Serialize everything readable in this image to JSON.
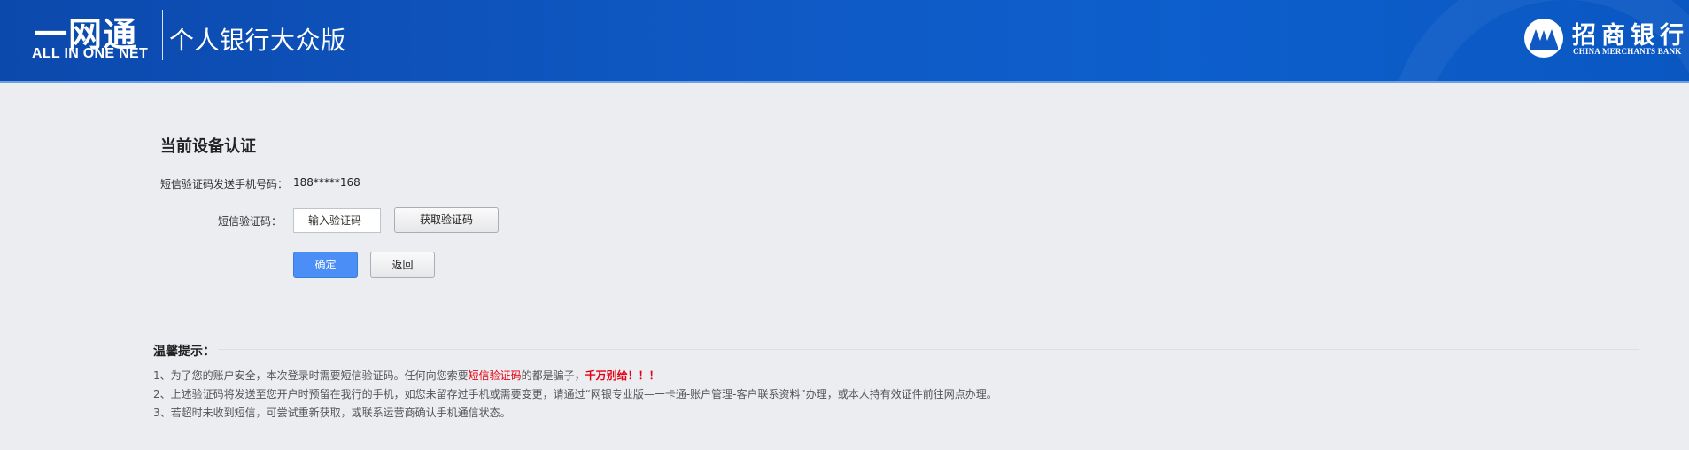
{
  "header": {
    "brand_cn": "一网通",
    "brand_en": "ALL IN ONE NET",
    "edition": "个人银行大众版",
    "bank_name": "招商银行",
    "bank_name_en": "CHINA MERCHANTS BANK",
    "colors": {
      "header_bg": "#0f59c4",
      "accent": "#4b8ef5",
      "warning": "#e60012"
    }
  },
  "form": {
    "title": "当前设备认证",
    "phone_label": "短信验证码发送手机号码：",
    "phone_value": "188*****168",
    "code_label": "短信验证码：",
    "code_placeholder": "输入验证码",
    "get_code_label": "获取验证码",
    "confirm_label": "确定",
    "back_label": "返回"
  },
  "tips": {
    "title": "温馨提示：",
    "tip1_prefix": "1、为了您的账户安全，本次登录时需要短信验证码。任何向您索要",
    "tip1_highlight": "短信验证码",
    "tip1_middle": "的都是骗子，",
    "tip1_warning": "千万别给！！！",
    "tip2": "2、上述验证码将发送至您开户时预留在我行的手机，如您未留存过手机或需要变更，请通过“网银专业版—一卡通-账户管理-客户联系资料”办理，或本人持有效证件前往网点办理。",
    "tip3": "3、若超时未收到短信，可尝试重新获取，或联系运营商确认手机通信状态。"
  }
}
